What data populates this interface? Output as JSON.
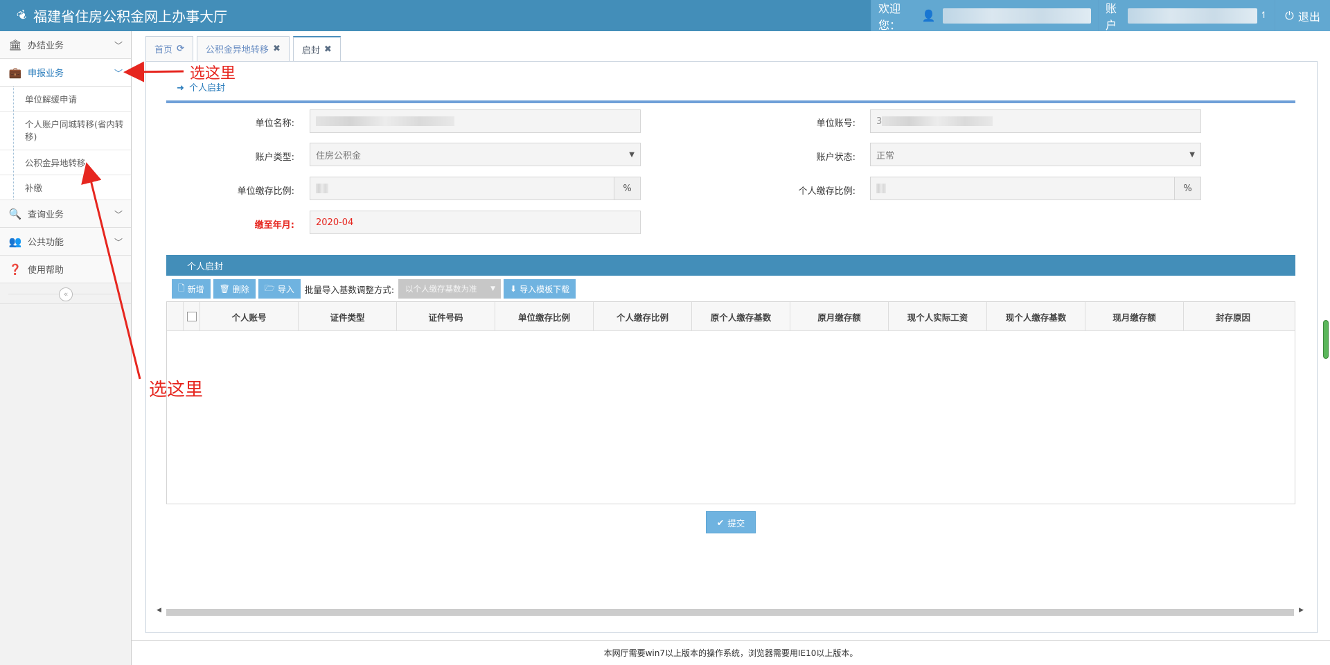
{
  "header": {
    "title": "福建省住房公积金网上办事大厅",
    "welcome_label": "欢迎您：",
    "account_label": "账户",
    "logout_label": "退出"
  },
  "sidebar": {
    "items": [
      {
        "label": "办结业务",
        "icon": "bank-icon"
      },
      {
        "label": "申报业务",
        "icon": "briefcase-icon"
      },
      {
        "label": "查询业务",
        "icon": "search-icon"
      },
      {
        "label": "公共功能",
        "icon": "users-icon"
      },
      {
        "label": "使用帮助",
        "icon": "question-icon"
      }
    ],
    "subitems": [
      "单位解缓申请",
      "个人账户同城转移(省内转移)",
      "公积金异地转移",
      "补缴"
    ],
    "collapse_glyph": "«"
  },
  "tabs": [
    {
      "label": "首页"
    },
    {
      "label": "公积金异地转移"
    },
    {
      "label": "启封"
    }
  ],
  "section": {
    "title": "个人启封"
  },
  "form": {
    "unit_name_label": "单位名称:",
    "unit_account_label": "单位账号:",
    "unit_account_value_prefix": "3",
    "account_type_label": "账户类型:",
    "account_type_value": "住房公积金",
    "account_status_label": "账户状态:",
    "account_status_value": "正常",
    "unit_ratio_label": "单位缴存比例:",
    "personal_ratio_label": "个人缴存比例:",
    "percent": "%",
    "paid_until_label": "缴至年月:",
    "paid_until_value": "2020-04"
  },
  "grid": {
    "title": "个人启封",
    "toolbar": {
      "add_label": "新增",
      "delete_label": "删除",
      "import_label": "导入",
      "batch_label": "批量导入基数调整方式:",
      "batch_select_value": "以个人缴存基数为准",
      "template_label": "导入模板下载"
    },
    "columns": [
      "个人账号",
      "证件类型",
      "证件号码",
      "单位缴存比例",
      "个人缴存比例",
      "原个人缴存基数",
      "原月缴存额",
      "现个人实际工资",
      "现个人缴存基数",
      "现月缴存额",
      "封存原因"
    ]
  },
  "submit_label": "提交",
  "footer_text": "本网厅需要win7以上版本的操作系统，浏览器需要用IE10以上版本。",
  "annotations": {
    "top": "选这里",
    "bottom": "选这里"
  },
  "colors": {
    "header": "#438eb9",
    "accent": "#2b7dbc",
    "annotation": "#e6261f"
  }
}
